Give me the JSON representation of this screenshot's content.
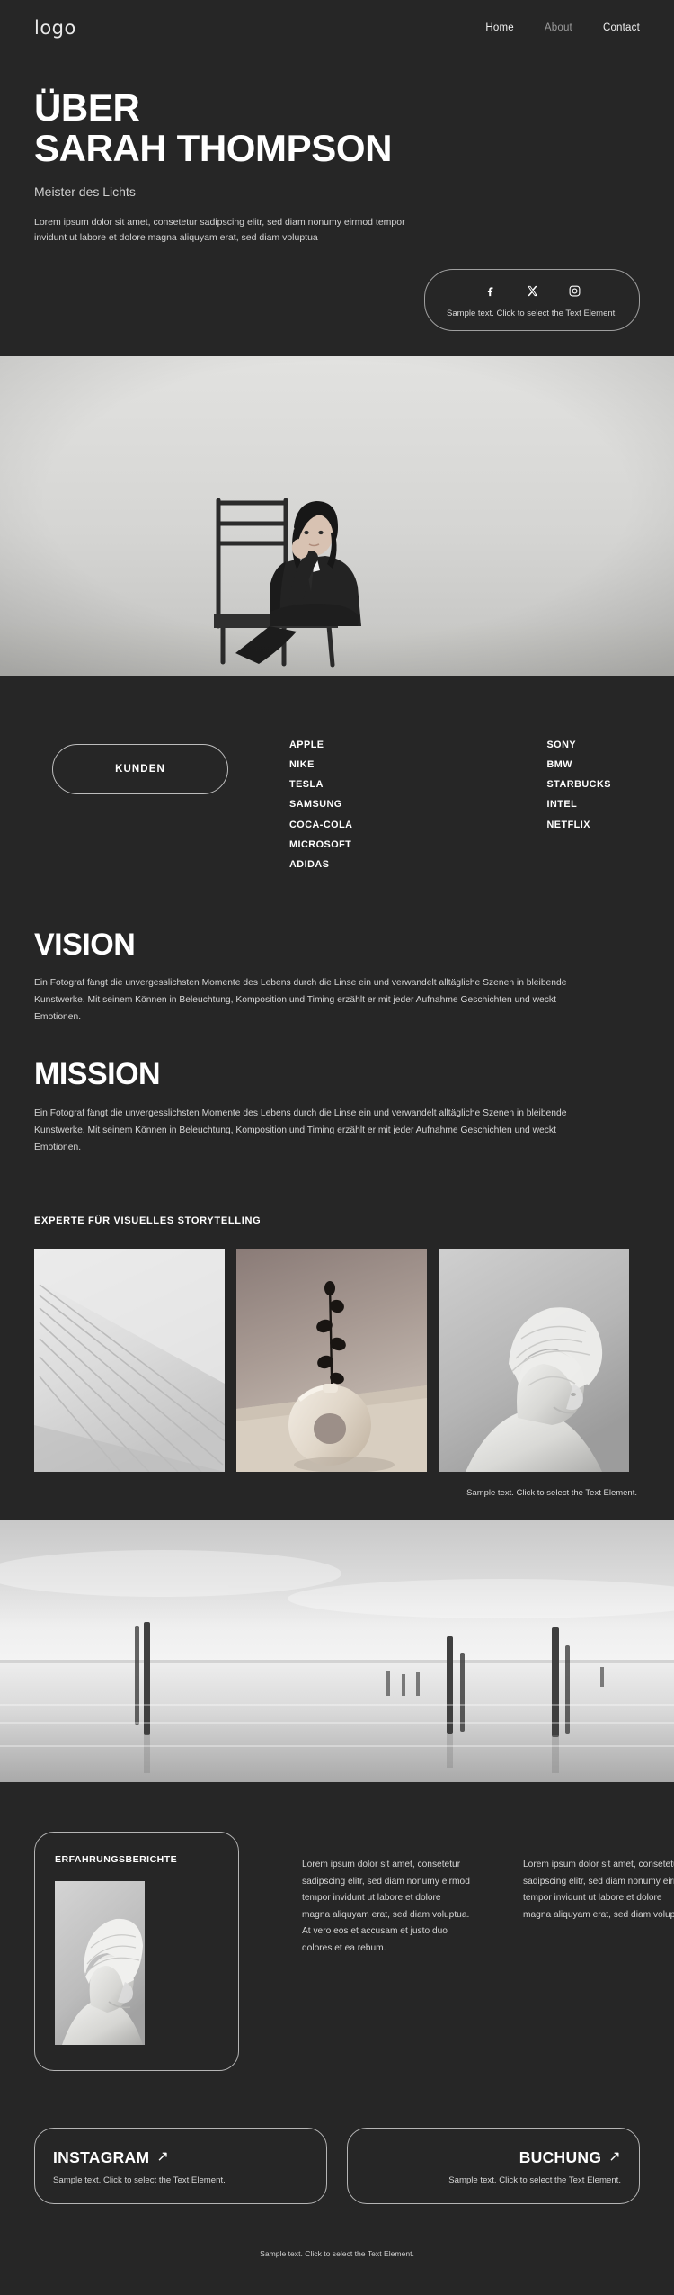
{
  "header": {
    "logo": "logo",
    "nav": [
      {
        "label": "Home",
        "muted": false
      },
      {
        "label": "About",
        "muted": true
      },
      {
        "label": "Contact",
        "muted": false
      }
    ]
  },
  "hero": {
    "title_line1": "ÜBER",
    "title_line2": "SARAH THOMPSON",
    "subtitle": "Meister des Lichts",
    "lede": "Lorem ipsum dolor sit amet, consetetur sadipscing elitr, sed diam nonumy eirmod tempor invidunt ut labore et dolore magna aliquyam erat, sed diam voluptua",
    "social": {
      "icons": [
        "facebook-icon",
        "x-twitter-icon",
        "instagram-icon"
      ],
      "caption": "Sample text. Click to select the Text Element."
    }
  },
  "clients": {
    "pill_label": "KUNDEN",
    "column_left": [
      "APPLE",
      "NIKE",
      "TESLA",
      "SAMSUNG",
      "COCA-COLA",
      "MICROSOFT",
      "ADIDAS"
    ],
    "column_right": [
      "SONY",
      "BMW",
      "STARBUCKS",
      "INTEL",
      "NETFLIX"
    ]
  },
  "vision": {
    "heading": "VISION",
    "body": "Ein Fotograf fängt die unvergesslichsten Momente des Lebens durch die Linse ein und verwandelt alltägliche Szenen in bleibende Kunstwerke. Mit seinem Können in Beleuchtung, Komposition und Timing erzählt er mit jeder Aufnahme Geschichten und weckt Emotionen."
  },
  "mission": {
    "heading": "MISSION",
    "body": "Ein Fotograf fängt die unvergesslichsten Momente des Lebens durch die Linse ein und verwandelt alltägliche Szenen in bleibende Kunstwerke. Mit seinem Können in Beleuchtung, Komposition und Timing erzählt er mit jeder Aufnahme Geschichten und weckt Emotionen."
  },
  "gallery": {
    "heading": "EXPERTE FÜR VISUELLES STORYTELLING",
    "items": [
      {
        "alt": "radiating-light-lines-photo"
      },
      {
        "alt": "ceramic-donut-vase-photo"
      },
      {
        "alt": "draped-sculpture-bust-photo"
      }
    ],
    "caption": "Sample text. Click to select the Text Element."
  },
  "landscape": {
    "alt": "misty-lake-wooden-posts-photo"
  },
  "testimonials": {
    "card_title": "ERFAHRUNGSBERICHTE",
    "card_photo_alt": "wrapped-portrait-sculpture-photo",
    "quotes": [
      "Lorem ipsum dolor sit amet, consetetur sadipscing elitr, sed diam nonumy eirmod tempor invidunt ut labore et dolore magna aliquyam erat, sed diam voluptua. At vero eos et accusam et justo duo dolores et ea rebum.",
      "Lorem ipsum dolor sit amet, consetetur sadipscing elitr, sed diam nonumy eirmod tempor invidunt ut labore et dolore magna aliquyam erat, sed diam voluptua."
    ]
  },
  "cta": [
    {
      "title": "INSTAGRAM",
      "arrow": "↗",
      "caption": "Sample text. Click to select the Text Element."
    },
    {
      "title": "BUCHUNG",
      "arrow": "↗",
      "caption": "Sample text. Click to select the Text Element."
    }
  ],
  "footer": {
    "caption": "Sample text. Click to select the Text Element."
  },
  "colors": {
    "background": "#262626",
    "text_primary": "#ffffff",
    "text_secondary": "#d4d4d4",
    "border": "#b5b5b5",
    "nav_muted": "#9a9a9a"
  }
}
